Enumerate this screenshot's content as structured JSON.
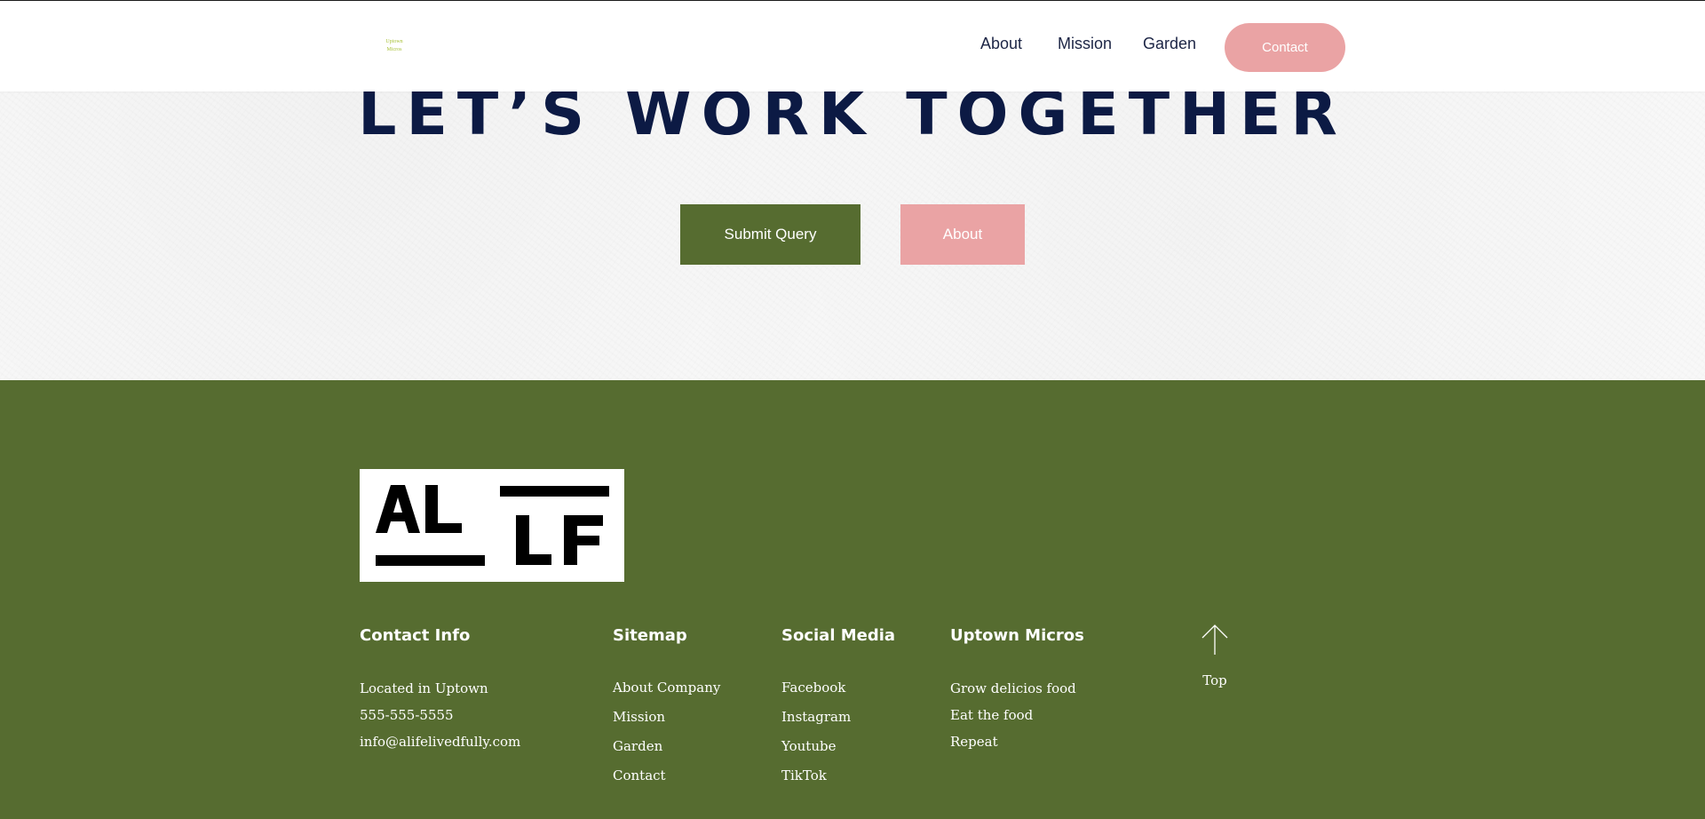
{
  "header": {
    "logo_line1": "Uptown",
    "logo_line2": "Micros",
    "nav": {
      "about": "About",
      "mission": "Mission",
      "garden": "Garden",
      "contact": "Contact"
    }
  },
  "hero": {
    "title": "LET’S WORK TOGETHER",
    "submit_label": "Submit Query",
    "about_label": "About"
  },
  "footer": {
    "brand_logo_letters": "ALLF",
    "contact": {
      "title": "Contact Info",
      "items": [
        "Located in Uptown",
        "555-555-5555",
        "info@alifelivedfully.com"
      ]
    },
    "sitemap": {
      "title": "Sitemap",
      "items": [
        "About Company",
        "Mission",
        "Garden",
        "Contact"
      ]
    },
    "social": {
      "title": "Social Media",
      "items": [
        "Facebook",
        "Instagram",
        "Youtube",
        "TikTok"
      ]
    },
    "micros": {
      "title": "Uptown Micros",
      "items": [
        "Grow delicios food",
        "Eat the food",
        "Repeat"
      ]
    },
    "top_label": "Top"
  },
  "colors": {
    "navy": "#0c1a44",
    "olive": "#566c30",
    "pink": "#eaa3a4",
    "logo_green": "#a9c23a"
  }
}
